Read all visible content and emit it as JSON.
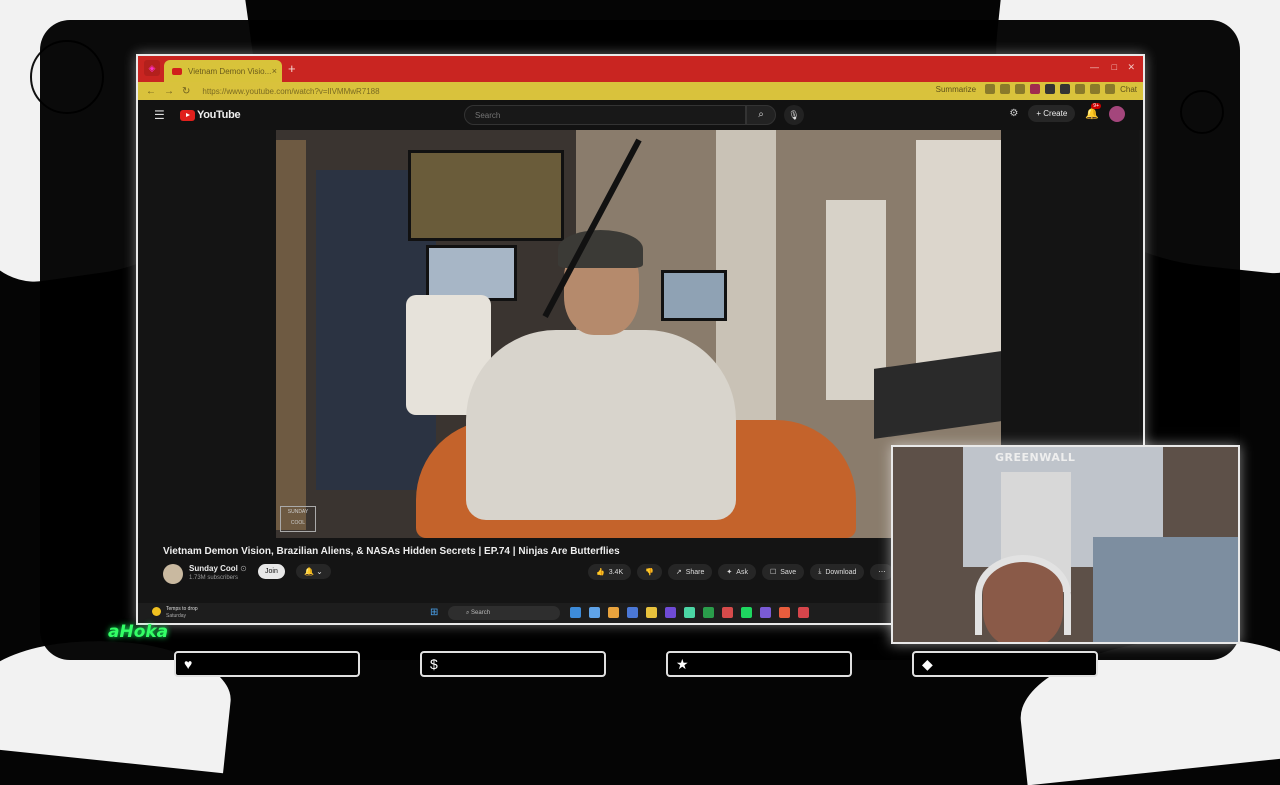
{
  "browser": {
    "tab_title": "Vietnam Demon Visio...",
    "tab_close": "×",
    "new_tab": "+",
    "url": "https://www.youtube.com/watch?v=lIVMMwR7188",
    "summarize_label": "Summarize",
    "chat_label": "Chat",
    "window_controls": [
      "—",
      "□",
      "✕"
    ]
  },
  "youtube": {
    "logo_text": "YouTube",
    "search_placeholder": "Search",
    "create_label": "Create",
    "notification_count": "9+"
  },
  "video": {
    "watermark": "SUNDAY COOL",
    "title": "Vietnam Demon Vision, Brazilian Aliens, & NASAs Hidden Secrets | EP.74 | Ninjas Are Butterflies",
    "channel_name": "Sunday Cool",
    "verified_badge": "⊙",
    "subscribers": "1.73M subscribers",
    "join_label": "Join",
    "actions": [
      {
        "icon": "👍",
        "label": "3.4K",
        "name": "like-button"
      },
      {
        "icon": "👎",
        "label": "",
        "name": "dislike-button"
      },
      {
        "icon": "↗",
        "label": "Share",
        "name": "share-button"
      },
      {
        "icon": "✦",
        "label": "Ask",
        "name": "ask-button"
      },
      {
        "icon": "☐",
        "label": "Save",
        "name": "save-button"
      },
      {
        "icon": "⤓",
        "label": "Download",
        "name": "download-button"
      },
      {
        "icon": "⋯",
        "label": "",
        "name": "more-actions-button"
      }
    ]
  },
  "taskbar": {
    "weather_line1": "Temps to drop",
    "weather_line2": "Saturday",
    "search_label": "Search",
    "app_colors": [
      "#3d8bd9",
      "#5fa3e8",
      "#e8a33d",
      "#4b78d6",
      "#e8c23d",
      "#6f4bd6",
      "#4bd6a5",
      "#2a9d4b",
      "#d64b4b",
      "#1ed760",
      "#7a5bd6",
      "#e85d3d",
      "#d6454b"
    ]
  },
  "webcam": {
    "sign_text": "GREENWALL"
  },
  "overlay": {
    "brand_text": "aHoka",
    "labels": [
      {
        "icon": "♥",
        "text": ""
      },
      {
        "icon": "$",
        "text": ""
      },
      {
        "icon": "★",
        "text": ""
      },
      {
        "icon": "◆",
        "text": ""
      }
    ]
  }
}
